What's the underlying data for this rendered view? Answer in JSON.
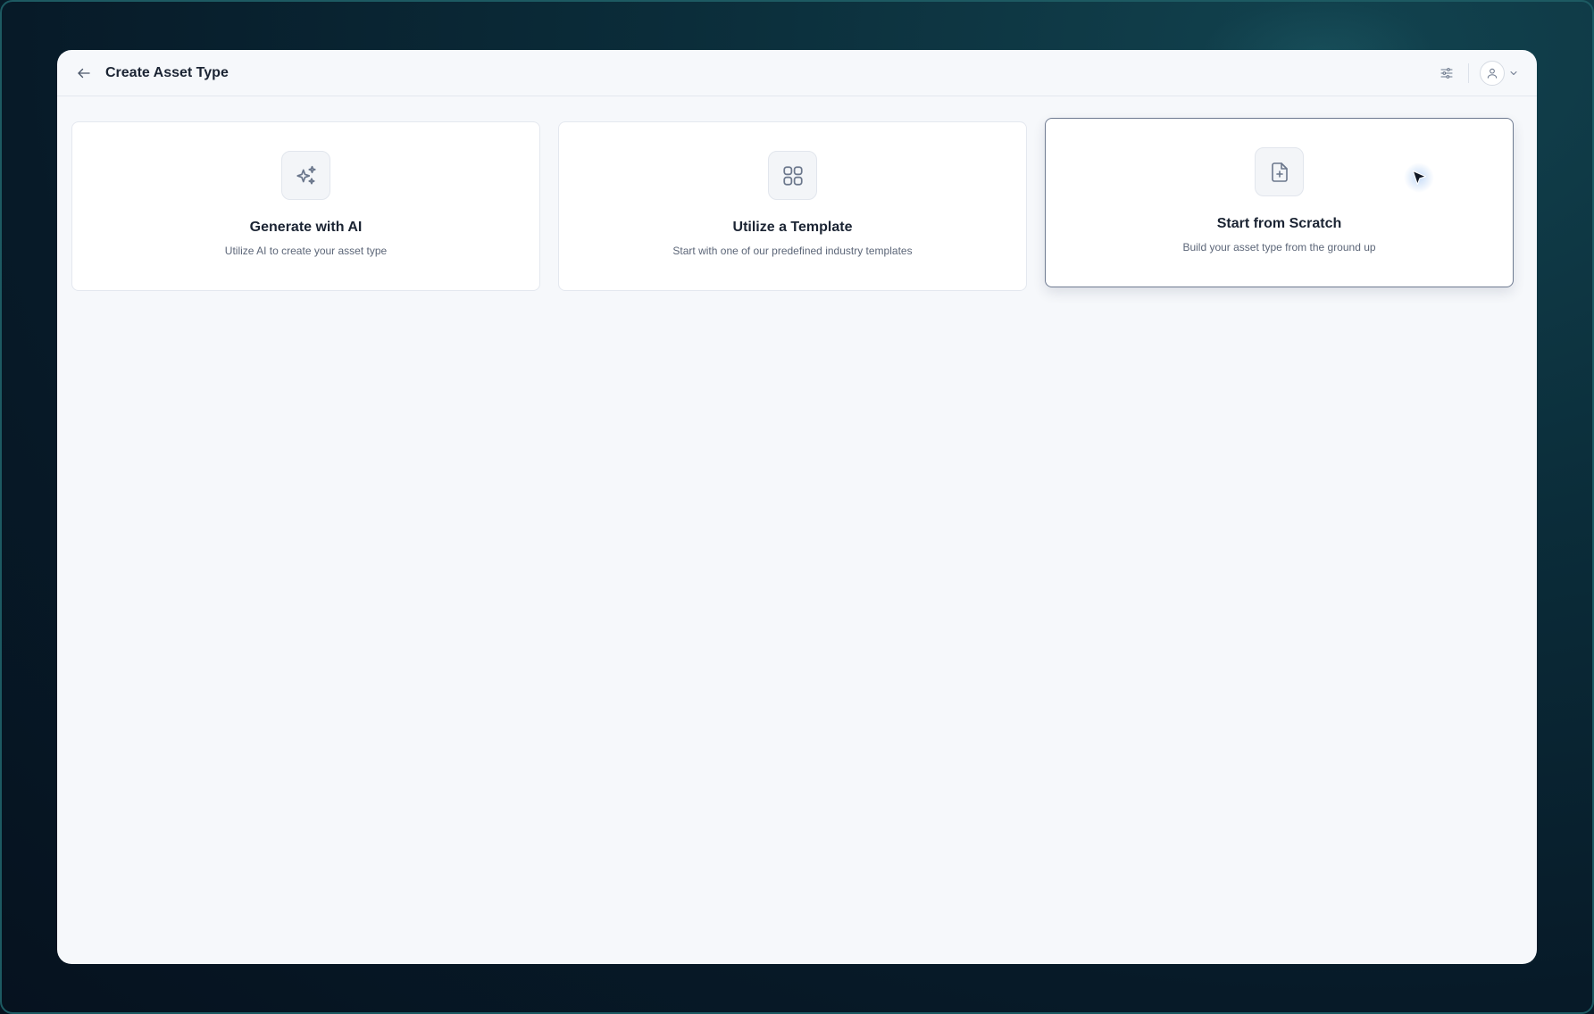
{
  "header": {
    "title": "Create Asset Type",
    "back_icon": "arrow-left-icon",
    "filter_icon": "sliders-icon",
    "user_icon": "user-icon",
    "chevron_icon": "chevron-down-icon"
  },
  "cards": [
    {
      "title": "Generate with AI",
      "description": "Utilize AI to create your asset type",
      "icon": "sparkles-icon"
    },
    {
      "title": "Utilize a Template",
      "description": "Start with one of our predefined industry templates",
      "icon": "grid-icon"
    },
    {
      "title": "Start from Scratch",
      "description": "Build your asset type from the ground up",
      "icon": "file-plus-icon",
      "state": "hovered"
    }
  ],
  "colors": {
    "background": "#071a28",
    "window": "#f6f8fb",
    "card": "#ffffff",
    "text_primary": "#1b2433",
    "text_secondary": "#5c6678",
    "icon": "#6b778c"
  }
}
